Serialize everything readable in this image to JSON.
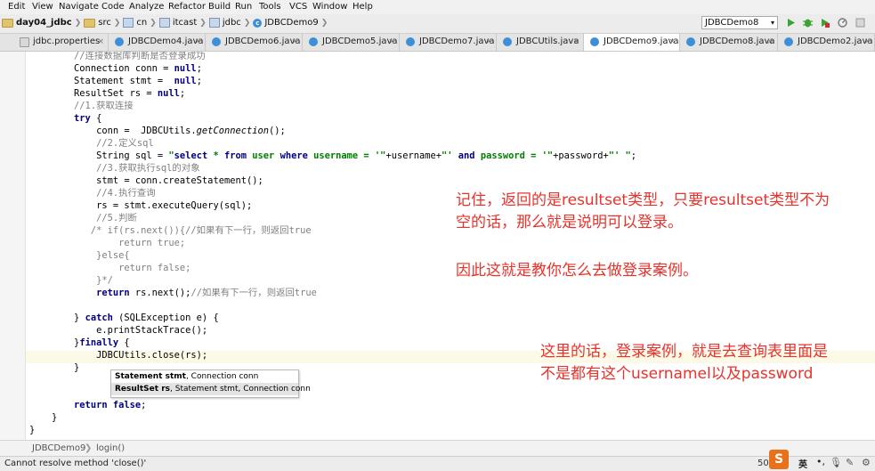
{
  "menu": [
    "Edit",
    "View",
    "Navigate",
    "Code",
    "Analyze",
    "Refactor",
    "Build",
    "Run",
    "Tools",
    "VCS",
    "Window",
    "Help"
  ],
  "breadcrumb": {
    "project": "day04_jdbc",
    "items": [
      "src",
      "cn",
      "itcast",
      "jdbc",
      "JDBCDemo9"
    ]
  },
  "run_config": "JDBCDemo8",
  "tabs": [
    {
      "label": "jdbc.properties",
      "icon": "properties-file-icon"
    },
    {
      "label": "JDBCDemo4.java",
      "icon": "java-class-icon"
    },
    {
      "label": "JDBCDemo6.java",
      "icon": "java-class-icon"
    },
    {
      "label": "JDBCDemo5.java",
      "icon": "java-class-icon"
    },
    {
      "label": "JDBCDemo7.java",
      "icon": "java-class-icon"
    },
    {
      "label": "JDBCUtils.java",
      "icon": "java-class-icon"
    },
    {
      "label": "JDBCDemo9.java",
      "icon": "java-class-icon",
      "active": true
    },
    {
      "label": "JDBCDemo8.java",
      "icon": "java-class-icon"
    },
    {
      "label": "JDBCDemo2.java",
      "icon": "java-class-icon"
    }
  ],
  "code_lines": [
    "        //连接数据库判断是否登录成功",
    "        Connection conn = null;",
    "        Statement stmt =  null;",
    "        ResultSet rs = null;",
    "        //1.获取连接",
    "        try {",
    "            conn =  JDBCUtils.getConnection();",
    "            //2.定义sql",
    "            String sql = \"select * from user where username = '\"+username+\"' and password = '\"+password+\"' \";",
    "            //3.获取执行sql的对象",
    "            stmt = conn.createStatement();",
    "            //4.执行查询",
    "            rs = stmt.executeQuery(sql);",
    "            //5.判断",
    "           /* if(rs.next()){//如果有下一行，则返回true",
    "                return true;",
    "            }else{",
    "                return false;",
    "            }*/",
    "            return rs.next();//如果有下一行，则返回true",
    "",
    "        } catch (SQLException e) {",
    "            e.printStackTrace();",
    "        }finally {",
    "            JDBCUtils.close(rs);",
    "        }",
    "",
    "",
    "        return false;",
    "    }",
    "}"
  ],
  "param_popup": {
    "option1_type": "Statement stmt",
    "option1_rest": ", Connection conn",
    "option2_type": "ResultSet rs",
    "option2_rest": ", Statement stmt, Connection conn"
  },
  "annotations": {
    "note1_line1": "记住，返回的是resultset类型，只要resultset类型不为",
    "note1_line2": "空的话，那么就是说明可以登录。",
    "note2": "因此这就是教你怎么去做登录案例。",
    "note3_line1": "这里的话，登录案例，就是去查询表里面是",
    "note3_line2": "不是都有这个usernamel以及password"
  },
  "editor_breadcrumb": [
    "JDBCDemo9",
    "login()"
  ],
  "status_message": "Cannot resolve method 'close()'",
  "status_right": "50",
  "ime": {
    "label": "英"
  },
  "colors": {
    "keyword": "#000080",
    "string": "#008000",
    "comment": "#808080",
    "annotation_red": "#e8322b",
    "tab_active": "#ffffff",
    "caret_line": "#fcfae6"
  }
}
